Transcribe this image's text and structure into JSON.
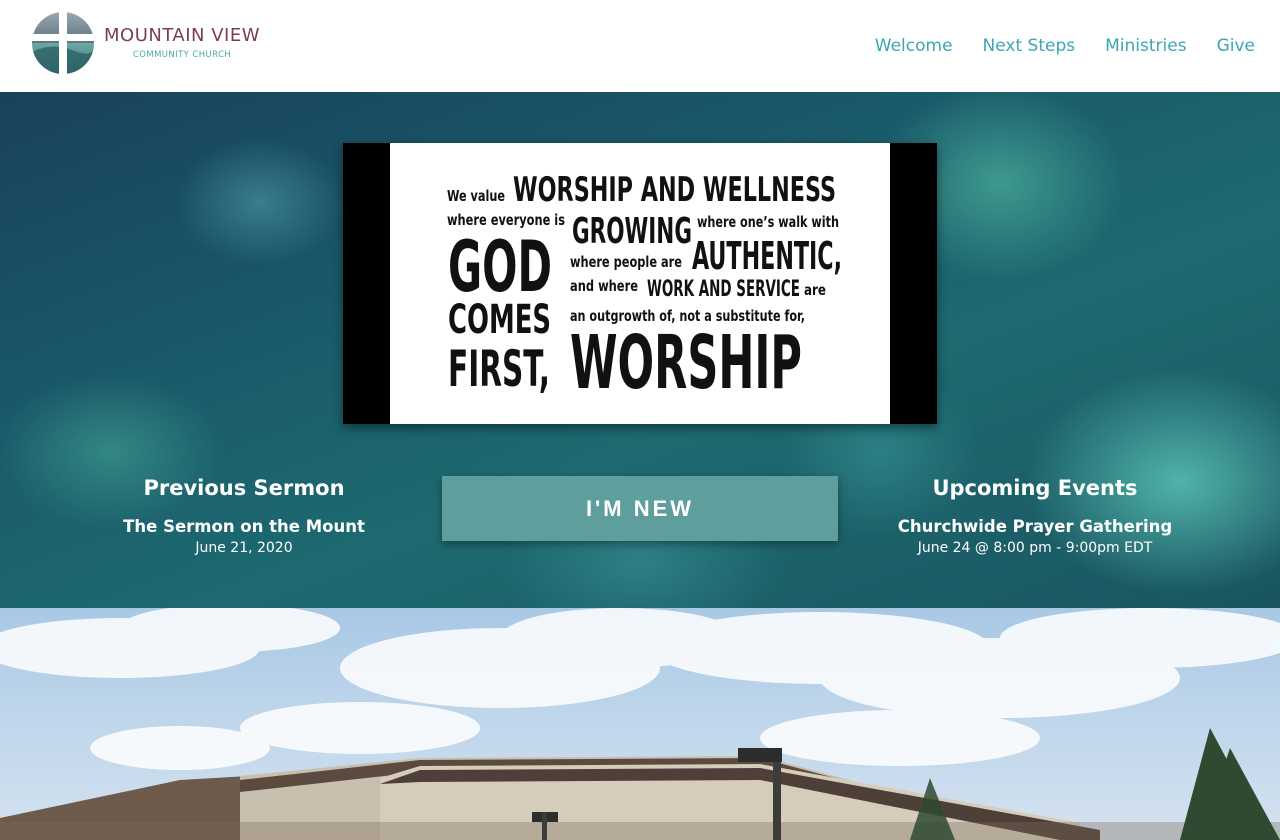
{
  "header": {
    "logo_title": "MOUNTAIN VIEW",
    "logo_subtitle": "COMMUNITY CHURCH",
    "nav": [
      "Welcome",
      "Next Steps",
      "Ministries",
      "Give"
    ]
  },
  "hero": {
    "banner_lines": {
      "l1a": "We value",
      "l1b": "WORSHIP AND WELLNESS",
      "l2a": "where everyone is",
      "l2b": "GROWING",
      "l2c": "where one’s walk with",
      "god": "GOD",
      "comes": "COMES",
      "first": "FIRST,",
      "l3a": "where people are",
      "l3b": "AUTHENTIC,",
      "l4a": "and where",
      "l4b": "WORK AND SERVICE",
      "l4c": "are",
      "l5": "an outgrowth of,  not a substitute for,",
      "worship": "WORSHIP"
    },
    "button_label": "I'M NEW",
    "previous_sermon": {
      "heading": "Previous Sermon",
      "title": "The Sermon on the Mount",
      "date": "June 21, 2020"
    },
    "upcoming_events": {
      "heading": "Upcoming Events",
      "title": "Churchwide Prayer Gathering",
      "date": "June 24 @ 8:00 pm - 9:00pm EDT"
    }
  },
  "colors": {
    "accent": "#3aa8b0",
    "brand": "#7a3f4a",
    "button": "#5e9e9c"
  }
}
